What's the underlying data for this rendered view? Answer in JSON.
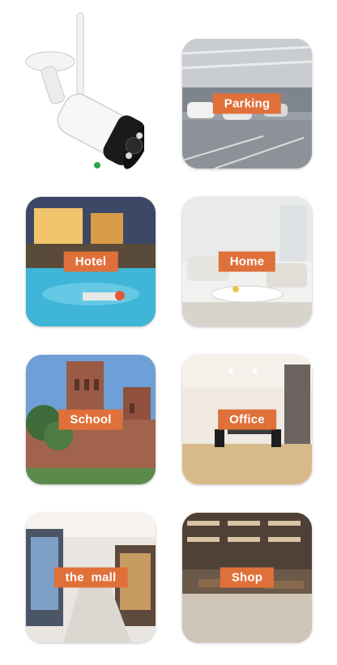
{
  "camera": {
    "icon": "security-camera-icon",
    "accent": "#ffffff"
  },
  "tiles": [
    {
      "id": "parking",
      "label": "Parking"
    },
    {
      "id": "hotel",
      "label": "Hotel"
    },
    {
      "id": "home",
      "label": "Home"
    },
    {
      "id": "school",
      "label": "School"
    },
    {
      "id": "office",
      "label": "Office"
    },
    {
      "id": "mall",
      "label": "the  mall"
    },
    {
      "id": "shop",
      "label": "Shop"
    }
  ],
  "colors": {
    "label_bg": "#e0703a",
    "label_text": "#ffffff"
  }
}
